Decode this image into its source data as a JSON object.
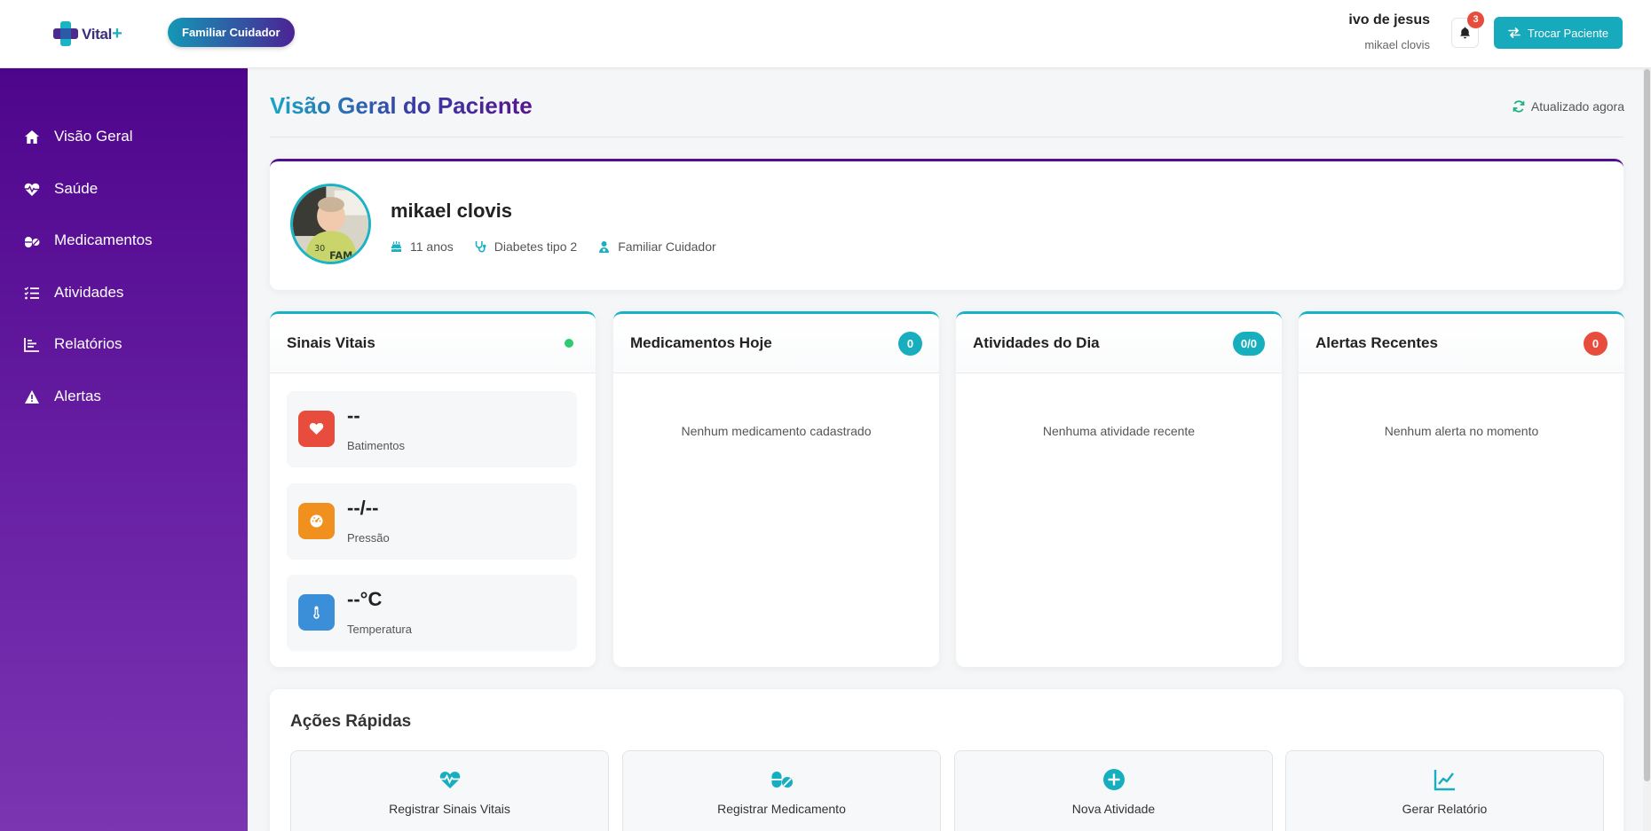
{
  "header": {
    "logo_text": "Vital",
    "logo_plus": "+",
    "role_badge": "Familiar Cuidador",
    "user_name": "ivo de jesus",
    "user_patient": "mikael clovis",
    "notifications_count": "3",
    "switch_patient_label": "Trocar Paciente"
  },
  "sidebar": {
    "items": [
      {
        "label": "Visão Geral",
        "icon": "home-icon"
      },
      {
        "label": "Saúde",
        "icon": "heart-pulse-icon"
      },
      {
        "label": "Medicamentos",
        "icon": "pills-icon"
      },
      {
        "label": "Atividades",
        "icon": "list-check-icon"
      },
      {
        "label": "Relatórios",
        "icon": "chart-bar-icon"
      },
      {
        "label": "Alertas",
        "icon": "warning-icon"
      }
    ]
  },
  "main": {
    "title_part1": "Visão Geral",
    "title_part2": " do Paciente",
    "updated_label": "Atualizado agora",
    "patient": {
      "name": "mikael clovis",
      "age": "11 anos",
      "condition": "Diabetes tipo 2",
      "relation": "Familiar Cuidador"
    },
    "vitals_card": {
      "title": "Sinais Vitais",
      "items": [
        {
          "value": "--",
          "label": "Batimentos",
          "color": "#e74c3c"
        },
        {
          "value": "--/--",
          "label": "Pressão",
          "color": "#f0901e"
        },
        {
          "value": "--°C",
          "label": "Temperatura",
          "color": "#3a8fd8"
        }
      ]
    },
    "meds_card": {
      "title": "Medicamentos Hoje",
      "count": "0",
      "empty": "Nenhum medicamento cadastrado"
    },
    "activities_card": {
      "title": "Atividades do Dia",
      "count": "0/0",
      "empty": "Nenhuma atividade recente"
    },
    "alerts_card": {
      "title": "Alertas Recentes",
      "count": "0",
      "empty": "Nenhum alerta no momento"
    },
    "quick_actions": {
      "title": "Ações Rápidas",
      "items": [
        {
          "label": "Registrar Sinais Vitais",
          "icon": "heart-pulse-icon"
        },
        {
          "label": "Registrar Medicamento",
          "icon": "pills-icon"
        },
        {
          "label": "Nova Atividade",
          "icon": "plus-circle-icon"
        },
        {
          "label": "Gerar Relatório",
          "icon": "chart-line-icon"
        }
      ]
    }
  },
  "colors": {
    "accent": "#17aebe",
    "sidebar_top": "#4e058c",
    "sidebar_bottom": "#7a35b1",
    "danger": "#e74c3c",
    "online": "#2ecc71"
  }
}
